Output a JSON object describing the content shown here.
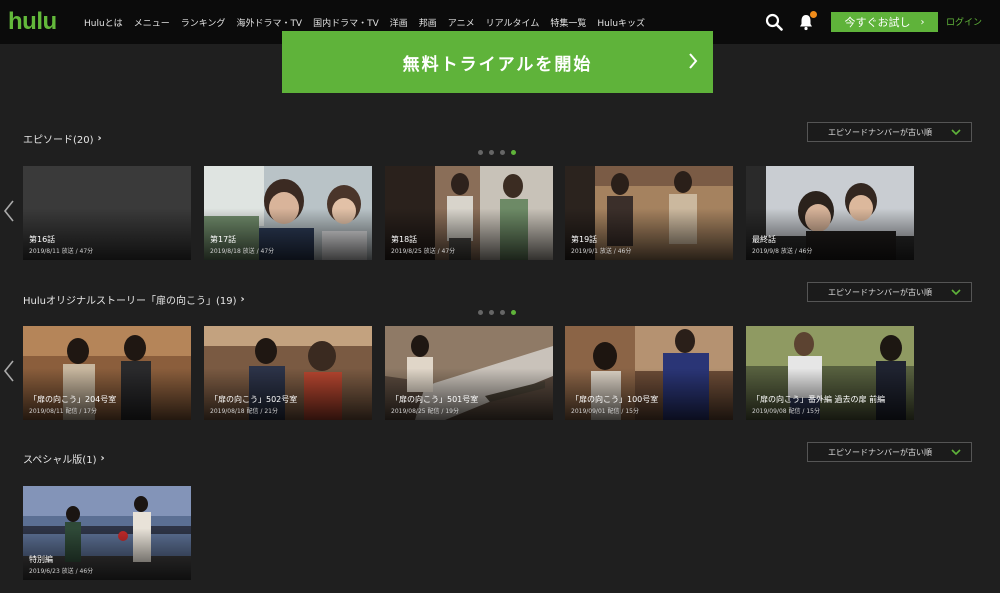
{
  "header": {
    "logo": "hulu",
    "nav": [
      "Huluとは",
      "メニュー",
      "ランキング",
      "海外ドラマ・TV",
      "国内ドラマ・TV",
      "洋画",
      "邦画",
      "アニメ",
      "リアルタイム",
      "特集一覧",
      "Huluキッズ"
    ],
    "search_icon": "search-icon",
    "bell_icon": "bell-icon",
    "trial_label": "今すぐお試し",
    "trial_arrow": "›",
    "login_label": "ログイン"
  },
  "cta": {
    "label": "無料トライアルを開始",
    "arrow": "›"
  },
  "colors": {
    "accent": "#5fb33a",
    "background": "#1f1f1f",
    "header": "#0b0b0b",
    "notification": "#f08c1a"
  },
  "sections": [
    {
      "title": "エピソード(20)",
      "sort": "エピソードナンバーが古い順",
      "pager_active": 4,
      "cards": [
        {
          "title": "第16話",
          "meta": "2019/8/11 放送 / 47分"
        },
        {
          "title": "第17話",
          "meta": "2019/8/18 放送 / 47分"
        },
        {
          "title": "第18話",
          "meta": "2019/8/25 放送 / 47分"
        },
        {
          "title": "第19話",
          "meta": "2019/9/1 放送 / 46分"
        },
        {
          "title": "最終話",
          "meta": "2019/9/8 放送 / 46分"
        }
      ]
    },
    {
      "title": "Huluオリジナルストーリー「扉の向こう」(19)",
      "sort": "エピソードナンバーが古い順",
      "pager_active": 4,
      "cards": [
        {
          "title": "「扉の向こう」204号室",
          "meta": "2019/08/11 配信 / 17分"
        },
        {
          "title": "「扉の向こう」502号室",
          "meta": "2019/08/18 配信 / 21分"
        },
        {
          "title": "「扉の向こう」501号室",
          "meta": "2019/08/25 配信 / 19分"
        },
        {
          "title": "「扉の向こう」100号室",
          "meta": "2019/09/01 配信 / 15分"
        },
        {
          "title": "「扉の向こう」番外編 過去の扉 前編",
          "meta": "2019/09/08 配信 / 15分"
        }
      ]
    },
    {
      "title": "スペシャル版(1)",
      "sort": "エピソードナンバーが古い順",
      "cards": [
        {
          "title": "特別編",
          "meta": "2019/6/23 放送 / 46分"
        }
      ]
    }
  ]
}
